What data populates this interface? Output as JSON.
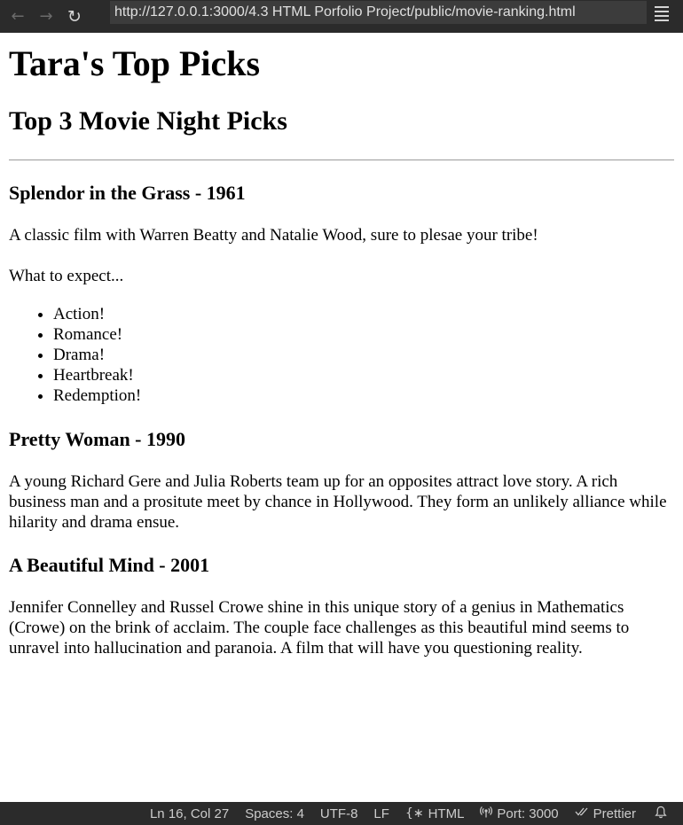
{
  "browser": {
    "url": "http://127.0.0.1:3000/4.3 HTML Porfolio Project/public/movie-ranking.html",
    "back_icon": "arrow-left-icon",
    "forward_icon": "arrow-right-icon",
    "reload_icon": "reload-icon",
    "menu_icon": "hamburger-menu-icon"
  },
  "page": {
    "title": "Tara's Top Picks",
    "subtitle": "Top 3 Movie Night Picks",
    "movies": [
      {
        "heading": "Splendor in the Grass - 1961",
        "description": "A classic film with Warren Beatty and Natalie Wood, sure to plesae your tribe!",
        "expect_label": "What to expect...",
        "expect_items": [
          "Action!",
          "Romance!",
          "Drama!",
          "Heartbreak!",
          "Redemption!"
        ]
      },
      {
        "heading": "Pretty Woman - 1990",
        "description": "A young Richard Gere and Julia Roberts team up for an opposites attract love story. A rich business man and a prositute meet by chance in Hollywood. They form an unlikely alliance while hilarity and drama ensue."
      },
      {
        "heading": "A Beautiful Mind - 2001",
        "description": "Jennifer Connelley and Russel Crowe shine in this unique story of a genius in Mathematics (Crowe) on the brink of acclaim. The couple face challenges as this beautiful mind seems to unravel into hallucination and paranoia. A film that will have you questioning reality."
      }
    ]
  },
  "statusbar": {
    "position": "Ln 16, Col 27",
    "spaces": "Spaces: 4",
    "encoding": "UTF-8",
    "eol": "LF",
    "language": "HTML",
    "language_icon": "braces-icon",
    "port": "Port: 3000",
    "port_icon": "broadcast-icon",
    "prettier": "Prettier",
    "prettier_icon": "double-check-icon",
    "bell_icon": "bell-icon"
  },
  "colors": {
    "chrome_bg": "#2b2b2b",
    "address_bg": "#3c3c3c",
    "page_bg": "#ffffff",
    "text": "#000000"
  }
}
